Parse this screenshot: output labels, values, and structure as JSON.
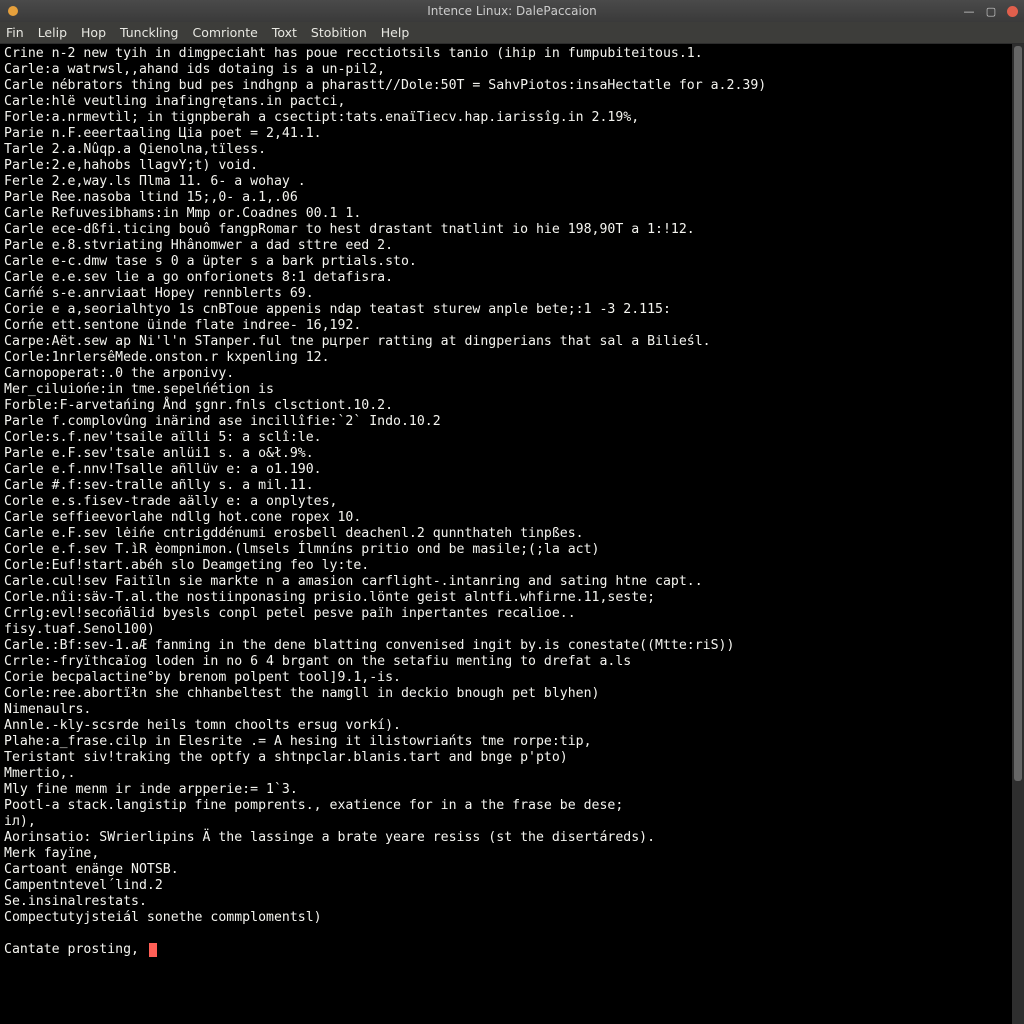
{
  "window": {
    "title": "Intence Linux: DaleРaccaion"
  },
  "menu": {
    "items": [
      "Fin",
      "Lelip",
      "Hop",
      "Tunckling",
      "Comrionte",
      "Toxt",
      "Stobition",
      "Help"
    ]
  },
  "terminal": {
    "lines": [
      "Crine n-2 new tyih in dimgpeciaht has poue recctiotsils tanio (ihip in fumpubiteitous.1.",
      "Carle:a watrwsl,,ahand ids dotaing is a un-pil2,",
      "Carle nébrators thing bud pes indhgnp a pharastt//Dole:50T = SahvPiotos:insaHectatle for a.2.39)",
      "Carle:hlë veutling inafingrętans.in pactci,",
      "Forle:a.nrmevtìl; in tignpberah a csectipt:tats.enaïTiecv.hap.iarissîg.in 2.19%,",
      "Parie n.F.eeertaaling Цia poet = 2,41.1.",
      "Tarle 2.a.Nûqp.a Qienolna,tïless.",
      "Parle:2.e,hahobs llagvY;t) void.",
      "Ferle 2.e,way.ls Пlma 11. 6- a wohay .",
      "Parle Ree.nasoba ltind 15;,0- a.1,.06",
      "Carle Refuvesibhams:in Mmp or.Coadnes 00.1 1.",
      "Carle ece-dßfi.ticing bouô fangpRomar to hest drastant tnatlint io hie 198,90T a 1:!12.",
      "Parle e.8.stvriating Hhânomwer a dad sttre eed 2.",
      "Carle e-c.dmw tase s 0 a üpter s a bark prtials.sto.",
      "Carle e.e.sev lie a go onforionets 8:1 detafisra.",
      "Carńé s-e.anrviaat Hopey rennblerts 69.",
      "Corie e a,seorialhtyo 1s cnBToue appenis ndap teatast sturew anple bete;:1 -3 2.115:",
      "Corńe ett.sentone üinde flate indree- 16,192.",
      "Carpe:Aët.sew ap Ni'l'n STanper.ful tne pцrper ratting at dingperians that sal a Bilieśl.",
      "Corle:1nrlersêMede.onston.r kxpenling 12.",
      "Carnopoperat:.0 the arponivy.",
      "Mer_ciluiońe:in tme.sepelńétion is",
      "Forble:F-arvetańing Ånd şgnr.fnls clsctiont.10.2.",
      "Parle f.complovûng inärind ase incillîfie:`2` Indo.10.2",
      "Corle:s.f.nev'tsaile aïlli 5: a sclî:le.",
      "Parle e.F.sev'tsale anlüi1 s. a o&ł.9%.",
      "Carle e.f.nnv!Tsalle añllüv e: a o1.190.",
      "Carle #.f:sev-tralle añlly s. a mil.11.",
      "Corle e.s.fisev-trade aälly e: a onplytes,",
      "Carle seffieevorlahe ndllg hot.cone ropex 10.",
      "Carle e.F.sev lėińe cntrigddénumi erosbell deachenl.2 qunnthateh tinpßes.",
      "Corle e.f.sev T.ìR èompnimon.(lmsels Ílmníns pritio ond be masile;(;la act)",
      "Corle:Euf!start.abéh slo Deamgeting feo ly:te.",
      "Carle.cul!sev Faitïln sie markte n a amasion carflight-.intanring and sating htne capt..",
      "Corle.nîi:säv-T.al.the nostiinponasing prisio.lönte geist alntfi.whfirne.11,seste;",
      "Crrlg:evl!secońālid byesls conpl petel pesve païh inpertantes recalioe..",
      "fisy.tuaf.Senol100)",
      "Carle.:Bf:sev-1.aÆ fanming in the dene blatting convenised ingit by.is conestate((Mtte:riS))",
      "Crrle:-fryïthcaïog loden in no 6 4 brgant on the setafiu menting to drefat a.ls",
      "Corie becpalactine°by brenom polpent tool]9.1,-is.",
      "Corle:ree.abortïłn she chhanbeltest the namgll in deckio bnough pet blyhen)",
      "Nimenaulrs.",
      "Annle.-kly-scsrde heils tomn choolts ersug vorkí).",
      "Plahe:a_frase.cilp in Elesrite .= A hesing it ilistowriańts tme rorpe:tip,",
      "Teristant siv!traking the optfy a shtnpclar.blanis.tart and bnge p'pto)",
      "Mmertio,.",
      "Mly fine menm ir inde arpperie:= 1`3.",
      "Pootl-a stack.langistip fine pomprents., exatience for in a the frase be dese;",
      "iл),",
      "Aorinsatio: SWrierlipins Ä the lassinge a brate yeare resiss (st the disertáreds).",
      "Merk fayïne,",
      "Cartoant enänge NOTSB.",
      "Campentntevel´lind.2",
      "Se.insinalrestats.",
      "Compectutyjsteiál sonethe commplomentsl)"
    ],
    "prompt": "Cantate prosting,"
  }
}
